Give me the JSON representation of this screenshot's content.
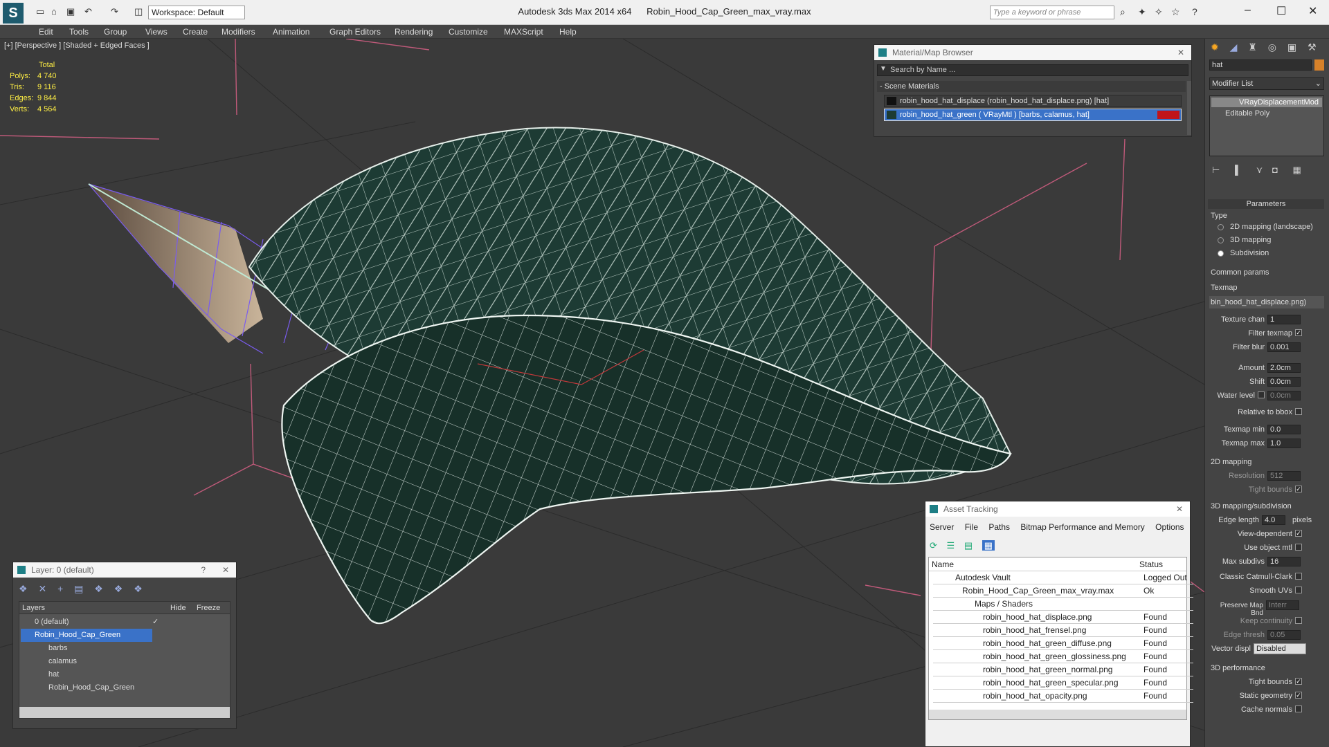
{
  "title_bar": {
    "app_title": "Autodesk 3ds Max  2014 x64",
    "file_title": "Robin_Hood_Cap_Green_max_vray.max",
    "workspace": "Workspace: Default",
    "search_placeholder": "Type a keyword or phrase",
    "help_label": "?"
  },
  "menu": [
    "Edit",
    "Tools",
    "Group",
    "Views",
    "Create",
    "Modifiers",
    "Animation",
    "Graph Editors",
    "Rendering",
    "Customize",
    "MAXScript",
    "Help"
  ],
  "viewport": {
    "label": "[+] [Perspective ] [Shaded + Edged Faces ]",
    "stats": {
      "total": "Total",
      "polys_k": "Polys:",
      "polys": "4 740",
      "tris_k": "Tris:",
      "tris": "9 116",
      "edges_k": "Edges:",
      "edges": "9 844",
      "verts_k": "Verts:",
      "verts": "4 564"
    }
  },
  "material_browser": {
    "title": "Material/Map Browser",
    "search_placeholder": "Search by Name ...",
    "section": "- Scene Materials",
    "items": [
      "robin_hood_hat_displace (robin_hood_hat_displace.png) [hat]",
      "robin_hood_hat_green  ( VRayMtl ) [barbs, calamus, hat]"
    ]
  },
  "layer_panel": {
    "title": "Layer: 0 (default)",
    "help": "?",
    "col_layers": "Layers",
    "col_hide": "Hide",
    "col_freeze": "Freeze",
    "rows": [
      "0 (default)",
      "Robin_Hood_Cap_Green",
      "barbs",
      "calamus",
      "hat",
      "Robin_Hood_Cap_Green"
    ]
  },
  "asset_tracking": {
    "title": "Asset Tracking",
    "menu": [
      "Server",
      "File",
      "Paths",
      "Bitmap Performance and Memory",
      "Options"
    ],
    "col_name": "Name",
    "col_status": "Status",
    "rows": [
      {
        "name": "Autodesk Vault",
        "status": "Logged Out"
      },
      {
        "name": "Robin_Hood_Cap_Green_max_vray.max",
        "status": "Ok"
      },
      {
        "name": "Maps / Shaders",
        "status": ""
      },
      {
        "name": "robin_hood_hat_displace.png",
        "status": "Found"
      },
      {
        "name": "robin_hood_hat_frensel.png",
        "status": "Found"
      },
      {
        "name": "robin_hood_hat_green_diffuse.png",
        "status": "Found"
      },
      {
        "name": "robin_hood_hat_green_glossiness.png",
        "status": "Found"
      },
      {
        "name": "robin_hood_hat_green_normal.png",
        "status": "Found"
      },
      {
        "name": "robin_hood_hat_green_specular.png",
        "status": "Found"
      },
      {
        "name": "robin_hood_hat_opacity.png",
        "status": "Found"
      }
    ]
  },
  "command_panel": {
    "object_name": "hat",
    "modifier_list": "Modifier List",
    "stack": [
      "VRayDisplacementMod",
      "Editable Poly"
    ],
    "parameters": "Parameters",
    "type_label": "Type",
    "types": [
      "2D mapping (landscape)",
      "3D mapping",
      "Subdivision"
    ],
    "common_params": "Common params",
    "texmap_label": "Texmap",
    "texmap_value": "bin_hood_hat_displace.png)",
    "texture_chan_label": "Texture chan",
    "texture_chan": "1",
    "filter_texmap": "Filter texmap",
    "filter_blur_label": "Filter blur",
    "filter_blur": "0.001",
    "amount_label": "Amount",
    "amount": "2.0cm",
    "shift_label": "Shift",
    "shift": "0.0cm",
    "water_level_label": "Water level",
    "water_level": "0.0cm",
    "relative_bbox": "Relative to bbox",
    "texmap_min_label": "Texmap min",
    "texmap_min": "0.0",
    "texmap_max_label": "Texmap max",
    "texmap_max": "1.0",
    "mapping_2d": "2D mapping",
    "resolution_label": "Resolution",
    "resolution": "512",
    "tight_bounds": "Tight bounds",
    "mapping_3d": "3D mapping/subdivision",
    "edge_length_label": "Edge length",
    "edge_length": "4.0",
    "pixels": "pixels",
    "view_dependent": "View-dependent",
    "use_object_mtl": "Use object mtl",
    "max_subdivs_label": "Max subdivs",
    "max_subdivs": "16",
    "classic_cc": "Classic Catmull-Clark",
    "smooth_uvs": "Smooth UVs",
    "preserve_map_bnd": "Preserve Map Bnd",
    "preserve_value": "Interr",
    "keep_continuity": "Keep continuity",
    "edge_thresh_label": "Edge thresh",
    "edge_thresh": "0.05",
    "vector_displ_label": "Vector displ",
    "vector_displ": "Disabled",
    "perf_3d": "3D performance",
    "tight_bounds2": "Tight bounds",
    "static_geometry": "Static geometry",
    "cache_normals": "Cache normals"
  },
  "colors": {
    "accent": "#3a72c8",
    "mesh": "#1d3b34",
    "grid": "#c05a7a"
  }
}
